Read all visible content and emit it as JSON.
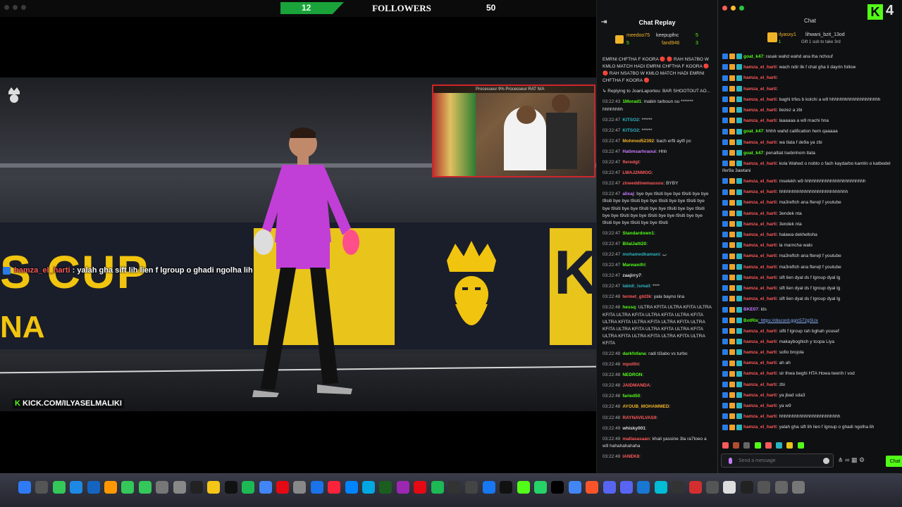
{
  "topbar": {
    "left_count": "12",
    "title": "FOLLOWERS",
    "right_count": "50"
  },
  "video": {
    "overlay_user": "hamza_el_harti",
    "overlay_text": ": yalah gha sift lih lien f lgroup o ghadi ngolha lih",
    "board_text_left": "S CUP",
    "board_text_left2": "NA",
    "board_text_right": "K",
    "kick_label_prefix": "K",
    "kick_label": "KICK.COM/ILYASELMALIKI",
    "cam_label": "Processeur",
    "cam_bar": "Processeur   9%   Processeur   RAT  N/A"
  },
  "replay": {
    "title": "Chat Replay",
    "pinned_user1": "meedoo75",
    "pinned_user2": "keepupfnc",
    "pinned_user3": "fand946",
    "pinned_c1": "5",
    "pinned_c2": "5",
    "pinned_c3": "3",
    "messages": [
      {
        "t": "",
        "u": "",
        "uc": "#ddd",
        "m": "EMRNI CHFTHA F KOORA  🔴 🔴  RAH NSA7BO W KMLO MATCH HADI EMRNI CHFTHA F KOORA 🔴 🔴 RAH NSA7BO W KMLO MATCH HADI EMRNI CHFTHA F KOORA 🔴"
      },
      {
        "t": "",
        "u": "",
        "uc": "#888",
        "m": "↳ Replying to JoanLaporteu: BAR SHOOTOUT AO..."
      },
      {
        "t": "03:22:43",
        "u": "1Morad1",
        "uc": "#53fc18",
        "m": ": mabin tarboun ou ******* hhhhhhhh"
      },
      {
        "t": "03:22:47",
        "u": "KITSO2",
        "uc": "#2bb3c0",
        "m": ": ******"
      },
      {
        "t": "03:22:47",
        "u": "KITSO2",
        "uc": "#2bb3c0",
        "m": ": ******"
      },
      {
        "t": "03:22:47",
        "u": "Mohmed52392",
        "uc": "#f0b429",
        "m": ": bach erfti aytfi pc"
      },
      {
        "t": "03:22:47",
        "u": "Hatimsarhraoui",
        "uc": "#c77dff",
        "m": ": Hhh"
      },
      {
        "t": "03:22:47",
        "u": "fleredgt",
        "uc": "#ff5a5a",
        "m": ":"
      },
      {
        "t": "03:22:47",
        "u": "LWAJ2NMOG",
        "uc": "#ff5a5a",
        "m": ":"
      },
      {
        "t": "03:22:47",
        "u": "zineeddinemassou",
        "uc": "#ff5a5a",
        "m": ": BYBY"
      },
      {
        "t": "03:22:47",
        "u": "alixaj",
        "uc": "#c77dff",
        "m": ": bye bye t9siti bye bye t9siti bye bye t9siti bye bye t9siti bye bye t9siti bye bye t9siti bye bye t9siti bye bye t9siti bye bye t9siti bye bye t9siti bye bye t9siti bye bye t9siti bye bye t9siti bye bye t9siti bye bye t9siti bye bye t9siti"
      },
      {
        "t": "03:22:47",
        "u": "Standardown1",
        "uc": "#53fc18",
        "m": ":"
      },
      {
        "t": "03:22:47",
        "u": "BilalJalti20",
        "uc": "#53fc18",
        "m": ":"
      },
      {
        "t": "03:22:47",
        "u": "mohamedkamani",
        "uc": "#2bb3c0",
        "m": ": ب"
      },
      {
        "t": "03:22:47",
        "u": "Marwanifri",
        "uc": "#53fc18",
        "m": ":"
      },
      {
        "t": "03:22:47",
        "u": "zaajirry7",
        "uc": "#ddd",
        "m": ":"
      },
      {
        "t": "03:22:47",
        "u": "labidi_ismail",
        "uc": "#2bb3c0",
        "m": ": ****"
      },
      {
        "t": "03:22:48",
        "u": "termet_gtd3k",
        "uc": "#ff5a5a",
        "m": ": yala bayno lina"
      },
      {
        "t": "03:22:48",
        "u": "hessq",
        "uc": "#53fc18",
        "m": ": ULTRA KFITA ULTRA KFITA ULTRA KFITA ULTRA KFITA ULTRA KFITA ULTRA KFITA ULTRA KFITA ULTRA KFITA ULTRA KFITA ULTRA KFITA ULTRA KFITA ULTRA KFITA ULTRA KFITA ULTRA KFITA ULTRA KFITA ULTRA KFITA ULTRA KFITA"
      },
      {
        "t": "03:22:48",
        "u": "darkfofana",
        "uc": "#53fc18",
        "m": ": radi ti3abo vs turbo"
      },
      {
        "t": "03:22:48",
        "u": "mpolthi",
        "uc": "#ff5a5a",
        "m": ":"
      },
      {
        "t": "03:22:48",
        "u": "NEDRON",
        "uc": "#53fc18",
        "m": ":"
      },
      {
        "t": "03:22:48",
        "u": "JAIDMANDA",
        "uc": "#ff5a5a",
        "m": ":"
      },
      {
        "t": "03:22:48",
        "u": "faried50",
        "uc": "#53fc18",
        "m": ":"
      },
      {
        "t": "03:22:48",
        "u": "AYOUB_MOHAMMED",
        "uc": "#f0b429",
        "m": ":"
      },
      {
        "t": "03:22:48",
        "u": "RAYNAVILVAS9",
        "uc": "#ff5a5a",
        "m": ":"
      },
      {
        "t": "03:22:49",
        "u": "whisky001",
        "uc": "#ddd",
        "m": ":"
      },
      {
        "t": "03:22:49",
        "u": "mallasasaan",
        "uc": "#ff5a5a",
        "m": ": khali yassine 3la ra7toeo a w9 hahahahahaha"
      },
      {
        "t": "03:22:49",
        "u": "IANEK8",
        "uc": "#ff5a5a",
        "m": ":"
      }
    ]
  },
  "chat": {
    "title": "Chat",
    "kick_logo": "K",
    "kick_num": "4",
    "pinned_user": "ilyasxy1",
    "pinned_user2": "lihwani_bzit_13od",
    "pinned_count": "1",
    "pinned_text": "Gift 1 sub to take 3rd",
    "input_placeholder": "Send a message",
    "send_label": "Chat",
    "messages": [
      {
        "u": "goat_k47",
        "cls": "ug",
        "m": ": rasak wahd wahd ana lha nchouf",
        "w": false
      },
      {
        "u": "hamza_el_harti",
        "cls": "u",
        "m": ": wach ndir lik f chat gha li dayrin follow",
        "w": false
      },
      {
        "u": "hamza_el_harti",
        "cls": "u",
        "m": ":",
        "w": false
      },
      {
        "u": "hamza_el_harti",
        "cls": "u",
        "m": ":",
        "w": false
      },
      {
        "u": "hamza_el_harti",
        "cls": "u",
        "m": ": baghi trfes b kolchi a w9 hhhhhhhhhhhhhhhhhhhh",
        "w": true
      },
      {
        "u": "hamza_el_harti",
        "cls": "u",
        "m": ": bezez a zbi",
        "w": false
      },
      {
        "u": "hamza_el_harti",
        "cls": "u",
        "m": ": laaaaaa a w9 machi hna",
        "w": false
      },
      {
        "u": "goat_k47",
        "cls": "ug",
        "m": ": hhhh wahd calification hem qaaaaa",
        "w": false
      },
      {
        "u": "hamza_el_harti",
        "cls": "u",
        "m": ": wa tlata f de9a ya zbi",
        "w": false
      },
      {
        "u": "goat_k47",
        "cls": "ug",
        "m": ": penaltiat lsebinhom tlata",
        "w": false
      },
      {
        "u": "hamza_el_harti",
        "cls": "u",
        "m": ": kola Wahed o nobto o fach kaydarbo kamlin o katbedel lfer9a 3awtani",
        "w": true
      },
      {
        "u": "hamza_el_harti",
        "cls": "u",
        "m": ": mselekh w9 hhhhhhhhhhhhhhhhhhhhhhhh",
        "w": false
      },
      {
        "u": "hamza_el_harti",
        "cls": "u",
        "m": ": hhhhhhhhhhhhhhhhhhhhhhhhhhh",
        "w": false
      },
      {
        "u": "hamza_el_harti",
        "cls": "u",
        "m": ": ma3reftch ana fterejt f youtube",
        "w": false
      },
      {
        "u": "hamza_el_harti",
        "cls": "u",
        "m": ": 3endek nta",
        "w": false
      },
      {
        "u": "hamza_el_harti",
        "cls": "u",
        "m": ": 3endek nta",
        "w": false
      },
      {
        "u": "hamza_el_harti",
        "cls": "u",
        "m": ": halawa dekheltoha",
        "w": false
      },
      {
        "u": "hamza_el_harti",
        "cls": "u",
        "m": ": la marncha walo",
        "w": false
      },
      {
        "u": "hamza_el_harti",
        "cls": "u",
        "m": ": ma3reftch ana fterejt f youtube",
        "w": false
      },
      {
        "u": "hamza_el_harti",
        "cls": "u",
        "m": ": ma3reftch ana fterejt f youtube",
        "w": false
      },
      {
        "u": "hamza_el_harti",
        "cls": "u",
        "m": ": sift lien dyal ds f lgroup dyal lg",
        "w": false
      },
      {
        "u": "hamza_el_harti",
        "cls": "u",
        "m": ": sift lien dyal ds f lgroup dyal lg",
        "w": false
      },
      {
        "u": "hamza_el_harti",
        "cls": "u",
        "m": ": sift lien dyal ds f lgroup dyal lg",
        "w": false
      },
      {
        "u": "BKE07",
        "cls": "up",
        "m": ": lds",
        "w": false
      },
      {
        "u": "BotRix",
        "cls": "ug",
        "m": ": https://discord.gg/c572gSUx",
        "w": false,
        "link": true
      },
      {
        "u": "hamza_el_harti",
        "cls": "u",
        "m": ": sifti f lgroup rah bghah yousef",
        "w": false
      },
      {
        "u": "hamza_el_harti",
        "cls": "u",
        "m": ": makayboghich y tcopa Liya",
        "w": false
      },
      {
        "u": "hamza_el_harti",
        "cls": "u",
        "m": ": sofio brojola",
        "w": false
      },
      {
        "u": "hamza_el_harti",
        "cls": "u",
        "m": ": ah ah",
        "w": false
      },
      {
        "u": "hamza_el_harti",
        "cls": "u",
        "m": ": sir thwa beghi HTA Howa twerih l vod",
        "w": false
      },
      {
        "u": "hamza_el_harti",
        "cls": "u",
        "m": ": zbi",
        "w": false
      },
      {
        "u": "hamza_el_harti",
        "cls": "u",
        "m": ": ya jbad sda3",
        "w": false
      },
      {
        "u": "hamza_el_harti",
        "cls": "u",
        "m": ": ya w9",
        "w": false
      },
      {
        "u": "hamza_el_harti",
        "cls": "u",
        "m": ": hhhhhhhhhhhhhhhhhhhhhhhh",
        "w": false
      },
      {
        "u": "hamza_el_harti",
        "cls": "u",
        "m": ": yalah gha sift lih lien f lgroup o ghadi ngolha lih",
        "w": false
      }
    ]
  },
  "dock": {
    "icons": [
      "finder-icon",
      "launchpad-icon",
      "messages-icon",
      "safari-icon",
      "mail-icon",
      "photos-icon",
      "facetime-icon",
      "phone-icon",
      "calculator-icon",
      "settings-icon",
      "terminal-icon",
      "notes-icon",
      "appletv-icon",
      "spotify-icon",
      "chrome-icon",
      "netflix-icon",
      "calculator-icon",
      "mirror-icon",
      "music-icon",
      "messenger-icon",
      "prime-video-icon",
      "betting-icon",
      "podcasts-icon",
      "netflix2-icon",
      "spotify2-icon",
      "obs-icon",
      "grid-icon",
      "facebook-icon",
      "speedtest-icon",
      "kick-icon",
      "whatsapp-icon",
      "x-icon",
      "chrome2-icon",
      "brave-icon",
      "discord-icon",
      "discord2-icon",
      "isp-icon",
      "vpn-icon",
      "files-icon",
      "screenrec-icon",
      "app-icon",
      "bulb-icon",
      "monitor-icon",
      "grid2-icon",
      "activity-icon",
      "trash-icon"
    ]
  }
}
